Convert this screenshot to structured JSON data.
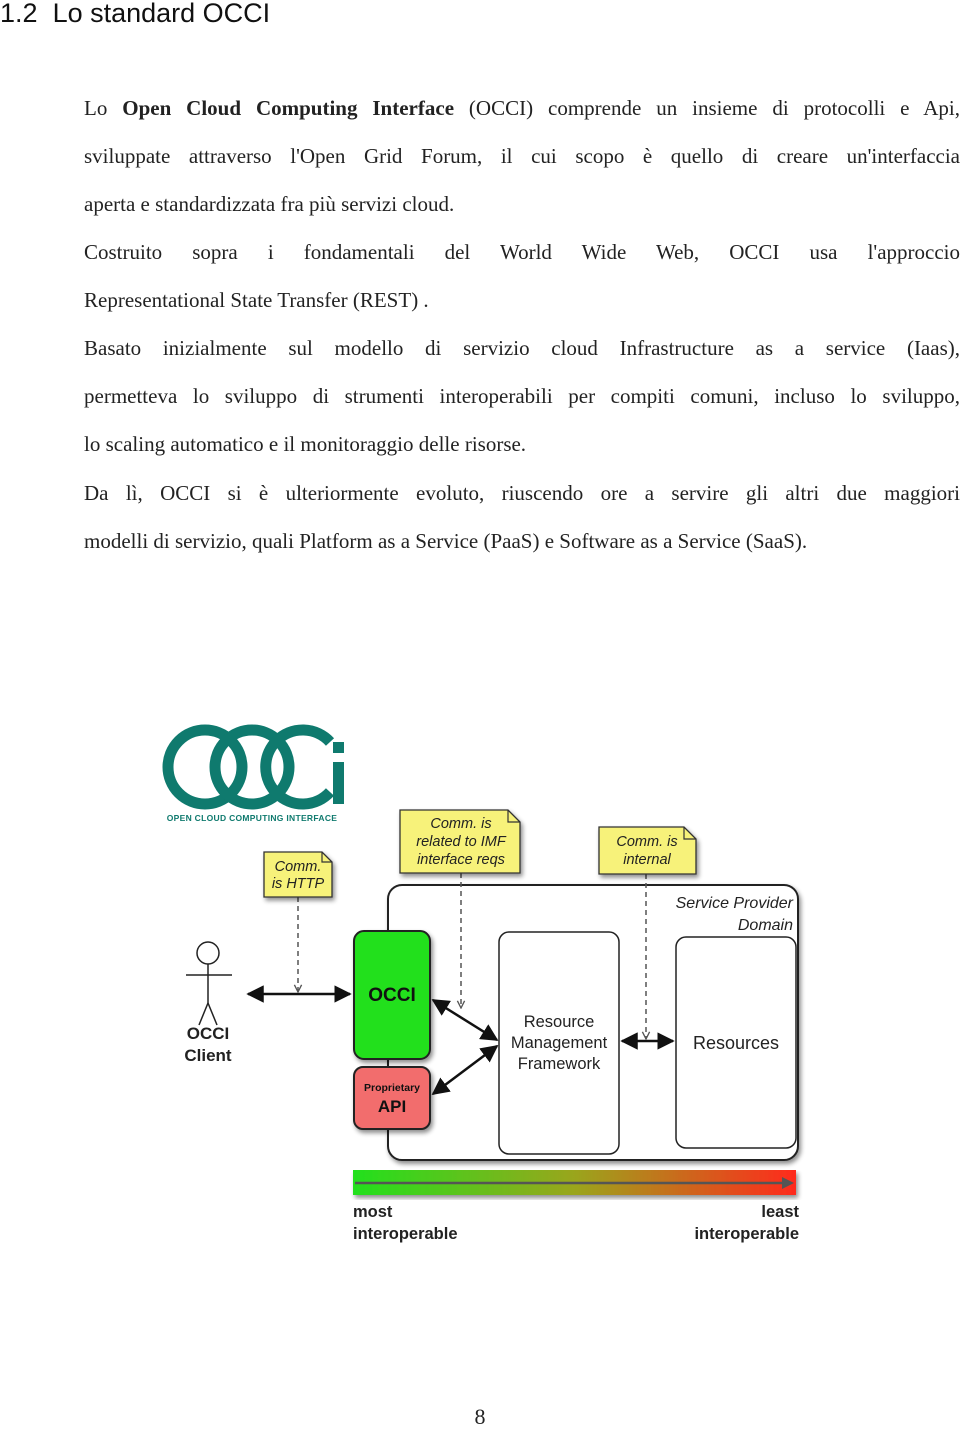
{
  "section": {
    "number": "1.2",
    "title": "Lo standard OCCI"
  },
  "paragraphs": [
    {
      "lines": [
        {
          "parts": [
            {
              "text": "Lo ",
              "bold": false
            },
            {
              "text": "Open Cloud Computing Interface",
              "bold": true
            },
            {
              "text": " (OCCI) comprende un insieme di protocolli e Api,",
              "bold": false
            }
          ]
        },
        {
          "text": "sviluppate attraverso l'Open Grid Forum, il cui scopo è quello di creare un'interfaccia"
        },
        {
          "text": "aperta e standardizzata fra più servizi cloud."
        }
      ]
    },
    {
      "lines": [
        {
          "text": "Costruito sopra i fondamentali del World Wide Web, OCCI usa l'approccio"
        },
        {
          "text": "Representational State Transfer (REST) ."
        }
      ]
    },
    {
      "lines": [
        {
          "text": "Basato inizialmente sul modello di servizio cloud Infrastructure as a service (Iaas),"
        },
        {
          "text": "permetteva lo sviluppo di strumenti interoperabili per compiti comuni, incluso lo sviluppo,"
        },
        {
          "text": "lo scaling automatico e il monitoraggio delle risorse."
        }
      ]
    },
    {
      "lines": [
        {
          "text": "Da lì, OCCI si è ulteriormente evoluto, riuscendo ore a servire gli altri due maggiori"
        },
        {
          "text": "modelli di servizio, quali Platform as a Service (PaaS) e Software as a Service (SaaS)."
        }
      ]
    }
  ],
  "figure": {
    "logo": {
      "letters": "OCCi",
      "tagline": "Open Cloud Computing Interface",
      "color": "#0f7a6e"
    },
    "notes": {
      "http": [
        "Comm.",
        "is HTTP"
      ],
      "imf": [
        "Comm. is",
        "related to IMF",
        "interface reqs"
      ],
      "internal": [
        "Comm. is",
        "internal"
      ]
    },
    "actor": {
      "label_line1": "OCCI",
      "label_line2": "Client"
    },
    "domain_label": [
      "Service Provider",
      "Domain"
    ],
    "occi_box": {
      "label": "OCCI",
      "color": "#22e01c"
    },
    "api_box": {
      "label_small": "Proprietary",
      "label": "API",
      "color": "#f26d6d"
    },
    "rmf_box": {
      "lines": [
        "Resource",
        "Management",
        "Framework"
      ]
    },
    "resources_box": {
      "label": "Resources"
    },
    "scale": {
      "left_label": [
        "most",
        "interoperable"
      ],
      "right_label": [
        "least",
        "interoperable"
      ],
      "color_start": "#22e01c",
      "color_end": "#ff2a1c"
    },
    "note_color": "#f7f27a"
  },
  "page_number": "8"
}
